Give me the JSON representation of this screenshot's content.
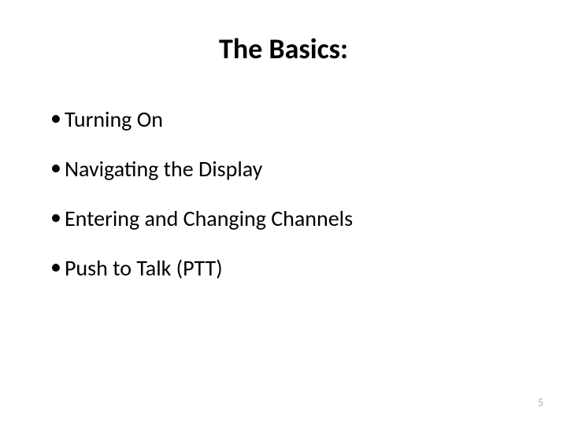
{
  "title": "The Basics:",
  "bullets": [
    "Turning On",
    "Navigating the Display",
    "Entering and Changing Channels",
    "Push to Talk (PTT)"
  ],
  "page_number": "5"
}
